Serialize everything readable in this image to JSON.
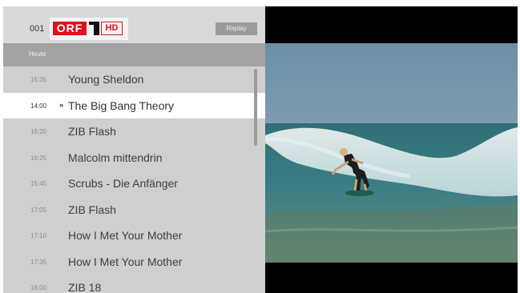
{
  "channel": {
    "number": "001",
    "logo_text": "ORF",
    "hd_text": "HD"
  },
  "replay_button": "Replay",
  "day_label": "Heute",
  "programs": [
    {
      "time": "15:35",
      "title": "Young Sheldon",
      "selected": false
    },
    {
      "time": "14:00",
      "title": "The Big Bang Theory",
      "selected": true
    },
    {
      "time": "16:20",
      "title": "ZIB Flash",
      "selected": false
    },
    {
      "time": "16:25",
      "title": "Malcolm mittendrin",
      "selected": false
    },
    {
      "time": "15:45",
      "title": "Scrubs - Die Anfänger",
      "selected": false
    },
    {
      "time": "17:05",
      "title": "ZIB Flash",
      "selected": false
    },
    {
      "time": "17:10",
      "title": "How I Met Your Mother",
      "selected": false
    },
    {
      "time": "17:35",
      "title": "How I Met Your Mother",
      "selected": false
    },
    {
      "time": "18:00",
      "title": "ZIB 18",
      "selected": false
    }
  ],
  "selected_marker": "»",
  "colors": {
    "brand_red": "#e3101a",
    "panel_bg": "#cfcfcf",
    "selected_row": "#ffffff"
  }
}
